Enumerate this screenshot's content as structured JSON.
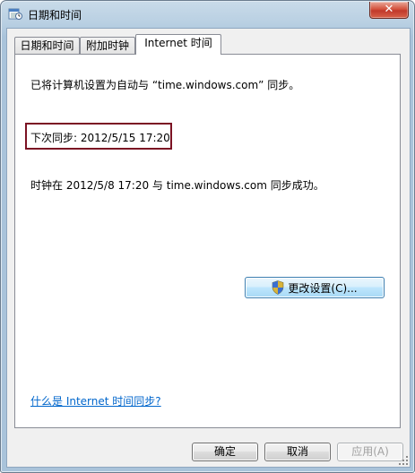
{
  "window": {
    "title": "日期和时间",
    "close_label": "✕"
  },
  "tabs": [
    {
      "label": "日期和时间"
    },
    {
      "label": "附加时钟"
    },
    {
      "label": "Internet 时间"
    }
  ],
  "panel": {
    "sync_setting": "已将计算机设置为自动与 “time.windows.com” 同步。",
    "next_sync": "下次同步: 2012/5/15 17:20",
    "last_sync": "时钟在 2012/5/8 17:20 与 time.windows.com 同步成功。",
    "change_settings_label": "更改设置(C)...",
    "help_link": "什么是 Internet 时间同步?"
  },
  "buttons": {
    "ok": "确定",
    "cancel": "取消",
    "apply": "应用(A)"
  },
  "colors": {
    "highlight_border": "#7b1223",
    "link": "#0066cc",
    "close_button": "#c0392b"
  }
}
